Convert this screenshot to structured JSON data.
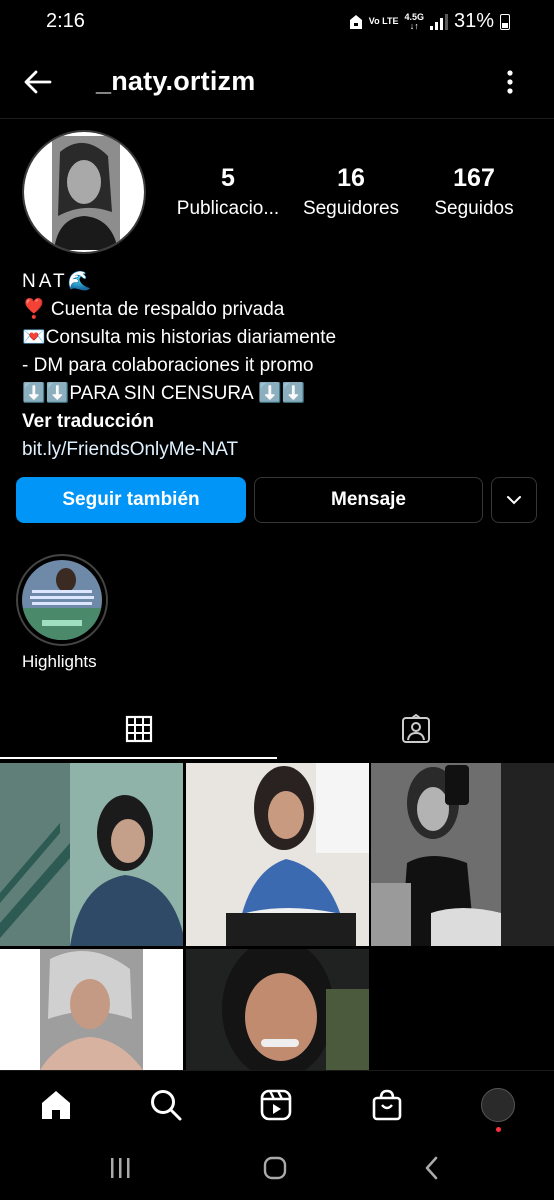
{
  "status": {
    "time": "2:16",
    "network_top": "Vo LTE",
    "network_type": "4.5G",
    "battery": "31%"
  },
  "header": {
    "username": "_naty.ortizm",
    "back_icon": "arrow-left-icon",
    "more_icon": "vertical-dots-icon"
  },
  "profile": {
    "stats": [
      {
        "value": "5",
        "label": "Publicacio..."
      },
      {
        "value": "16",
        "label": "Seguidores"
      },
      {
        "value": "167",
        "label": "Seguidos"
      }
    ],
    "bio": {
      "name": "NAT🌊",
      "lines": [
        "❣️ Cuenta de respaldo privada",
        "💌Consulta mis historias diariamente",
        "- DM para colaboraciones it promo",
        "⬇️⬇️PARA SIN CENSURA ⬇️⬇️"
      ],
      "translate": "Ver traducción",
      "link": "bit.ly/FriendsOnlyMe-NAT"
    }
  },
  "actions": {
    "follow_back": "Seguir también",
    "message": "Mensaje",
    "suggested_icon": "chevron-down-icon"
  },
  "highlights": [
    {
      "label": "Highlights"
    }
  ],
  "tabs": [
    {
      "name": "posts",
      "icon": "grid-icon",
      "active": true
    },
    {
      "name": "tagged",
      "icon": "tagged-person-icon",
      "active": false
    }
  ],
  "colors": {
    "accent": "#0095f6",
    "background": "#000000",
    "border": "#363636",
    "link": "#e0f1ff"
  }
}
